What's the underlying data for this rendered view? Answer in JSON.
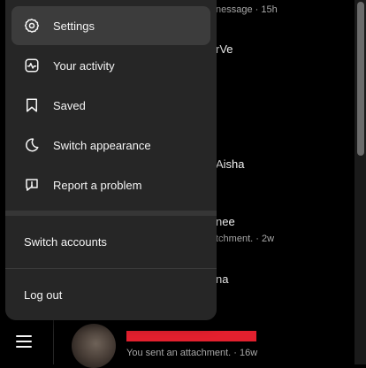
{
  "menu": {
    "items": [
      {
        "label": "Settings",
        "icon": "settings-icon",
        "active": true
      },
      {
        "label": "Your activity",
        "icon": "activity-icon",
        "active": false
      },
      {
        "label": "Saved",
        "icon": "bookmark-icon",
        "active": false
      },
      {
        "label": "Switch appearance",
        "icon": "moon-icon",
        "active": false
      },
      {
        "label": "Report a problem",
        "icon": "report-icon",
        "active": false
      }
    ],
    "switch_accounts": "Switch accounts",
    "log_out": "Log out"
  },
  "background": {
    "fragments": [
      {
        "text": "nessage · 15h"
      },
      {
        "text": "rVe"
      },
      {
        "text": "Aisha"
      },
      {
        "text": "nee"
      },
      {
        "text": "tchment. · 2w"
      },
      {
        "text": "na"
      }
    ],
    "conversation": {
      "last_message": "You sent an attachment. · 16w"
    }
  },
  "colors": {
    "page_bg": "#000000",
    "menu_bg": "#262626",
    "active_item_bg": "#3c3c3c",
    "redaction": "#e3202e",
    "text_primary": "#f5f5f5",
    "text_secondary": "#a8a8a8"
  }
}
